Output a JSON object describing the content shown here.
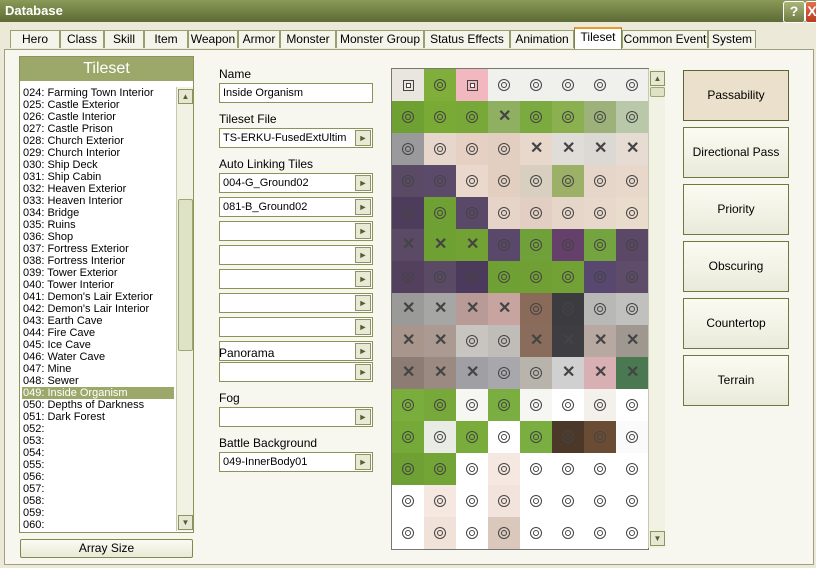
{
  "window": {
    "title": "Database",
    "help_label": "?",
    "close_label": "X"
  },
  "tabs": [
    {
      "label": "Hero"
    },
    {
      "label": "Class"
    },
    {
      "label": "Skill"
    },
    {
      "label": "Item"
    },
    {
      "label": "Weapon"
    },
    {
      "label": "Armor"
    },
    {
      "label": "Monster"
    },
    {
      "label": "Monster Group"
    },
    {
      "label": "Status Effects"
    },
    {
      "label": "Animation"
    },
    {
      "label": "Tileset"
    },
    {
      "label": "Common Event"
    },
    {
      "label": "System"
    }
  ],
  "active_tab": "Tileset",
  "tileset_list": {
    "header": "Tileset",
    "items": [
      "024: Farming Town Interior",
      "025: Castle Exterior",
      "026: Castle Interior",
      "027: Castle Prison",
      "028: Church Exterior",
      "029: Church Interior",
      "030: Ship Deck",
      "031: Ship Cabin",
      "032: Heaven Exterior",
      "033: Heaven Interior",
      "034: Bridge",
      "035: Ruins",
      "036: Shop",
      "037: Fortress Exterior",
      "038: Fortress Interior",
      "039: Tower Exterior",
      "040: Tower Interior",
      "041: Demon's Lair Exterior",
      "042: Demon's Lair Interior",
      "043: Earth Cave",
      "044: Fire Cave",
      "045: Ice Cave",
      "046: Water Cave",
      "047: Mine",
      "048: Sewer",
      "049: Inside Organism",
      "050: Depths of Darkness",
      "051: Dark Forest",
      "052:",
      "053:",
      "054:",
      "055:",
      "056:",
      "057:",
      "058:",
      "059:",
      "060:"
    ],
    "selected": "049: Inside Organism",
    "array_size_label": "Array Size"
  },
  "form": {
    "name_label": "Name",
    "name_value": "Inside Organism",
    "tileset_file_label": "Tileset File",
    "tileset_file_value": "TS-ERKU-FusedExtUltim",
    "auto_linking_label": "Auto Linking Tiles",
    "auto_linking": [
      "004-G_Ground02",
      "081-B_Ground02",
      "",
      "",
      "",
      "",
      "",
      ""
    ],
    "panorama_label": "Panorama",
    "panorama_value": "",
    "fog_label": "Fog",
    "fog_value": "",
    "battle_background_label": "Battle Background",
    "battle_background_value": "049-InnerBody01",
    "dropdown_arrow": "►"
  },
  "tile_marks": [
    [
      "sq",
      "o",
      "sq",
      "o",
      "o",
      "o",
      "o",
      "o"
    ],
    [
      "o",
      "o",
      "o",
      "x",
      "o",
      "o",
      "o",
      "o"
    ],
    [
      "o",
      "o",
      "o",
      "o",
      "x",
      "x",
      "x",
      "x"
    ],
    [
      "o",
      "o",
      "o",
      "o",
      "o",
      "o",
      "o",
      "o"
    ],
    [
      "o",
      "o",
      "o",
      "o",
      "o",
      "o",
      "o",
      "o"
    ],
    [
      "x",
      "x",
      "x",
      "o",
      "o",
      "o",
      "o",
      "o"
    ],
    [
      "o",
      "o",
      "o",
      "o",
      "o",
      "o",
      "o",
      "o"
    ],
    [
      "x",
      "x",
      "x",
      "x",
      "o",
      "o",
      "o",
      "o"
    ],
    [
      "x",
      "x",
      "o",
      "o",
      "x",
      "x",
      "x",
      "x"
    ],
    [
      "x",
      "x",
      "x",
      "o",
      "o",
      "x",
      "x",
      "x"
    ],
    [
      "o",
      "o",
      "o",
      "o",
      "o",
      "o",
      "o",
      "o"
    ],
    [
      "o",
      "o",
      "o",
      "o",
      "o",
      "o",
      "o",
      "o"
    ],
    [
      "o",
      "o",
      "o",
      "o",
      "o",
      "o",
      "o",
      "o"
    ],
    [
      "o",
      "o",
      "o",
      "o",
      "o",
      "o",
      "o",
      "o"
    ],
    [
      "o",
      "o",
      "o",
      "o",
      "o",
      "o",
      "o",
      "o"
    ]
  ],
  "modes": [
    {
      "label": "Passability"
    },
    {
      "label": "Directional Pass"
    },
    {
      "label": "Priority"
    },
    {
      "label": "Obscuring"
    },
    {
      "label": "Countertop"
    },
    {
      "label": "Terrain"
    }
  ],
  "active_mode": "Passability",
  "scroll_up": "▲",
  "scroll_down": "▼"
}
